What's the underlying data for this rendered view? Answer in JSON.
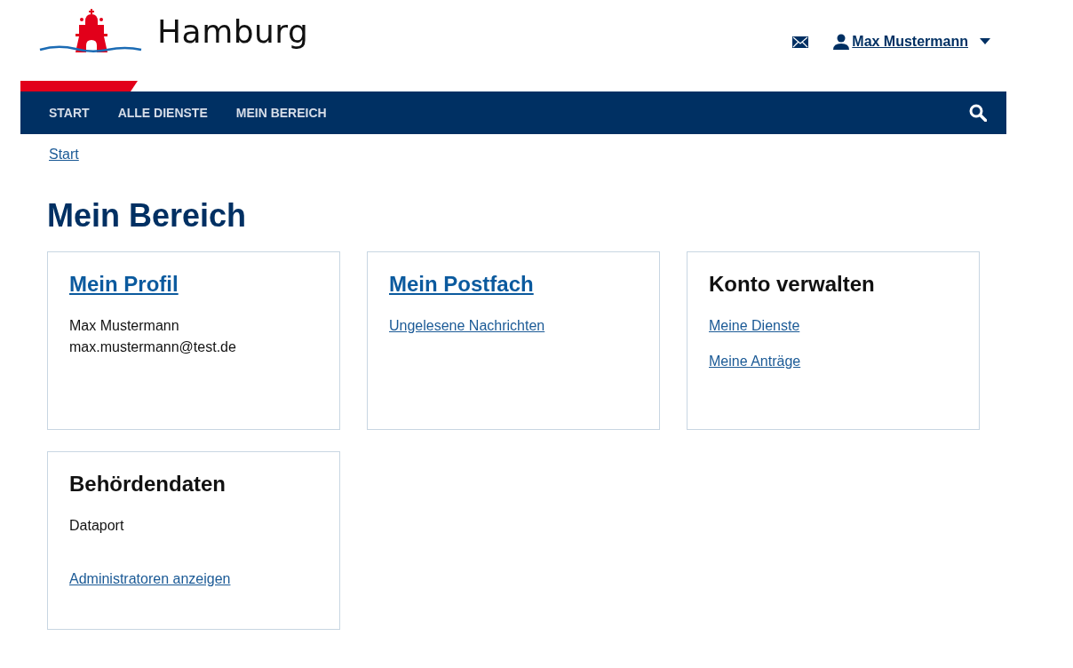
{
  "header": {
    "logo_text": "Hamburg",
    "user_name": "Max Mustermann"
  },
  "nav": {
    "items": [
      {
        "label": "START"
      },
      {
        "label": "ALLE DIENSTE"
      },
      {
        "label": "MEIN BEREICH"
      }
    ]
  },
  "breadcrumb": [
    "Start"
  ],
  "page_title": "Mein Bereich",
  "cards": [
    {
      "title": {
        "kind": "link",
        "text": "Mein Profil"
      },
      "items": [
        {
          "kind": "text",
          "text": "Max Mustermann"
        },
        {
          "kind": "text",
          "text": "max.mustermann@test.de"
        }
      ]
    },
    {
      "title": {
        "kind": "link",
        "text": "Mein Postfach"
      },
      "items": [
        {
          "kind": "link",
          "text": "Ungelesene Nachrichten"
        }
      ]
    },
    {
      "title": {
        "kind": "heading",
        "text": "Konto verwalten"
      },
      "items": [
        {
          "kind": "link",
          "text": "Meine Dienste"
        },
        {
          "kind": "link",
          "text": "Meine Anträge"
        }
      ]
    },
    {
      "title": {
        "kind": "heading",
        "text": "Behördendaten"
      },
      "items": [
        {
          "kind": "text",
          "text": "Dataport"
        },
        {
          "kind": "footer-link",
          "text": "Administratoren anzeigen"
        }
      ]
    }
  ]
}
